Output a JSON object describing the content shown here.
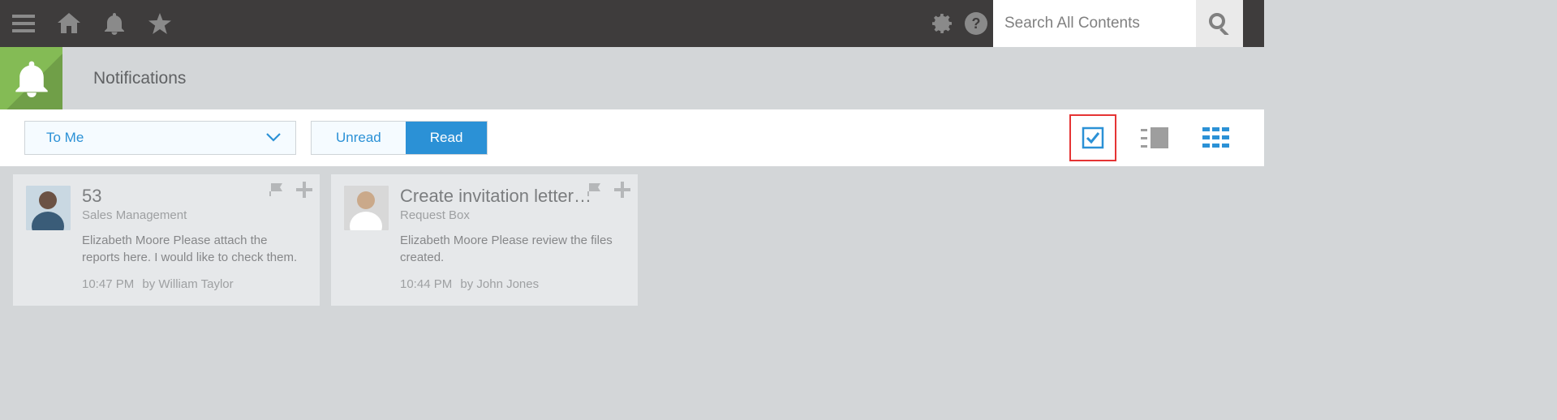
{
  "topbar": {
    "search_placeholder": "Search All Contents"
  },
  "page": {
    "title": "Notifications"
  },
  "toolbar": {
    "filter_label": "To Me",
    "toggle_unread": "Unread",
    "toggle_read": "Read"
  },
  "cards": [
    {
      "title": "53",
      "sub": "Sales Management",
      "msg": "Elizabeth Moore Please attach the reports here. I would like to check them.",
      "time": "10:47 PM",
      "by": "by William Taylor"
    },
    {
      "title": "Create invitation letter…",
      "sub": "Request Box",
      "msg": "Elizabeth Moore Please review the files created.",
      "time": "10:44 PM",
      "by": "by John Jones"
    }
  ]
}
